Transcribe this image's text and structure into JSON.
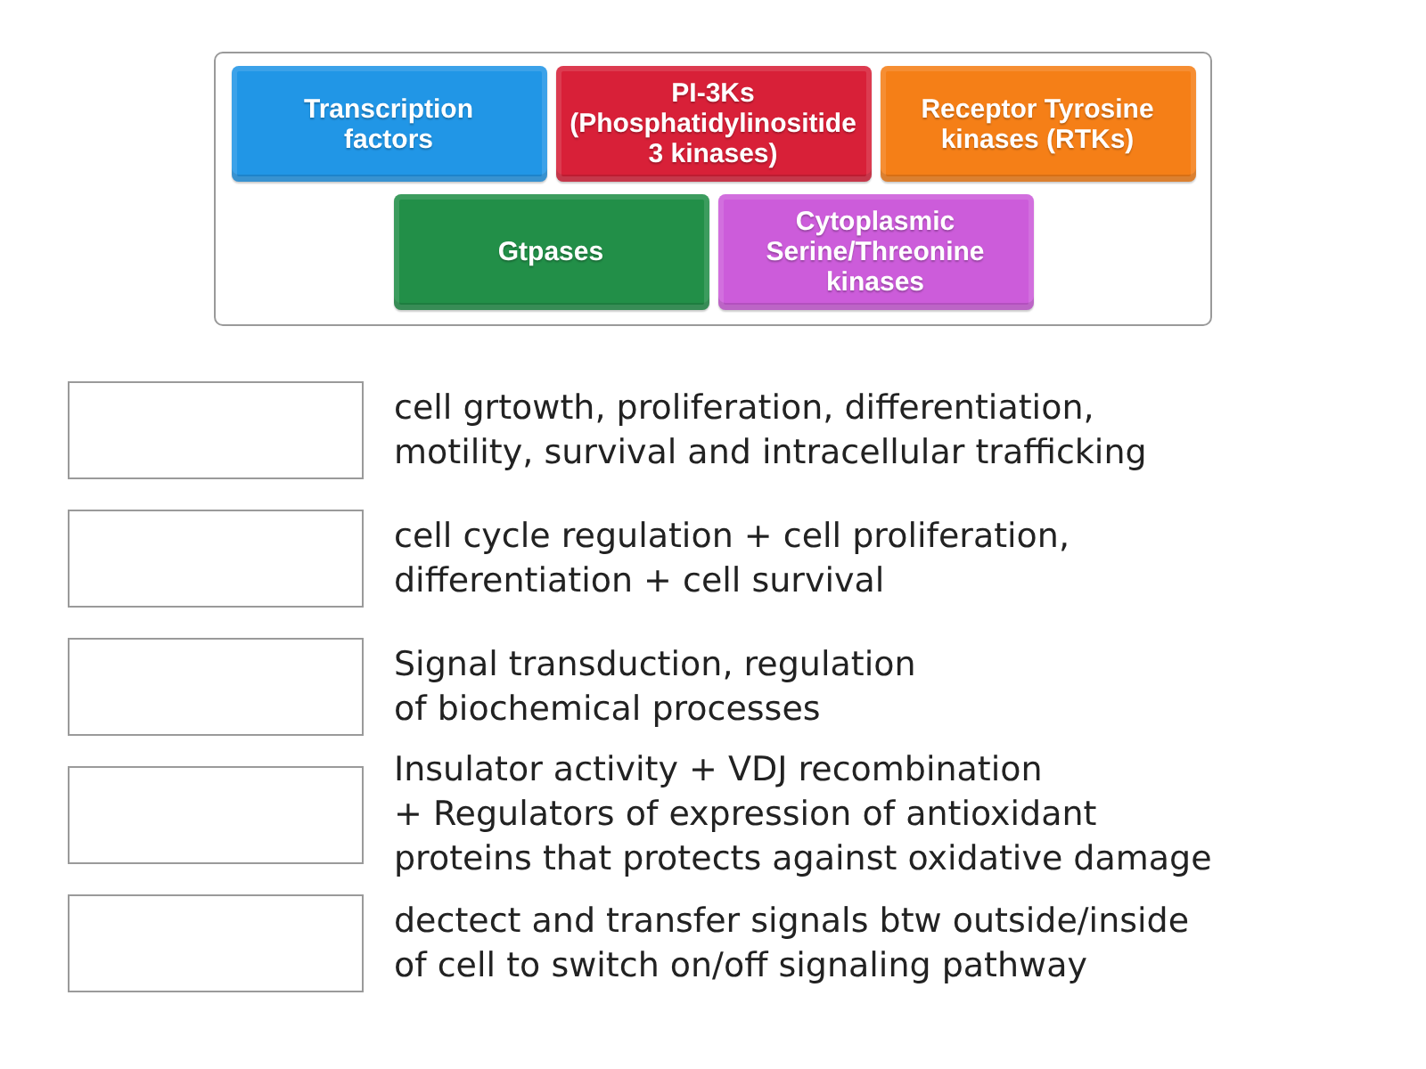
{
  "tiles": [
    {
      "label": "Transcription\nfactors",
      "color": "#2196e6"
    },
    {
      "label": "PI-3Ks\n(Phosphatidylinositide\n3 kinases)",
      "color": "#d82038"
    },
    {
      "label": "Receptor Tyrosine\nkinases (RTKs)",
      "color": "#f57f17"
    },
    {
      "label": "Gtpases",
      "color": "#228f48"
    },
    {
      "label": "Cytoplasmic\nSerine/Threonine\nkinases",
      "color": "#cc5cda"
    }
  ],
  "rows": [
    {
      "description": "cell grtowth, proliferation, differentiation,\nmotility, survival and intracellular trafficking"
    },
    {
      "description": "cell cycle regulation + cell proliferation,\ndifferentiation + cell survival"
    },
    {
      "description": "Signal transduction, regulation\nof biochemical processes"
    },
    {
      "description": "Insulator activity + VDJ recombination\n+ Regulators of expression of antioxidant\nproteins that protects against oxidative damage"
    },
    {
      "description": "dectect and transfer signals btw outside/inside\nof cell to switch on/off signaling pathway"
    }
  ]
}
